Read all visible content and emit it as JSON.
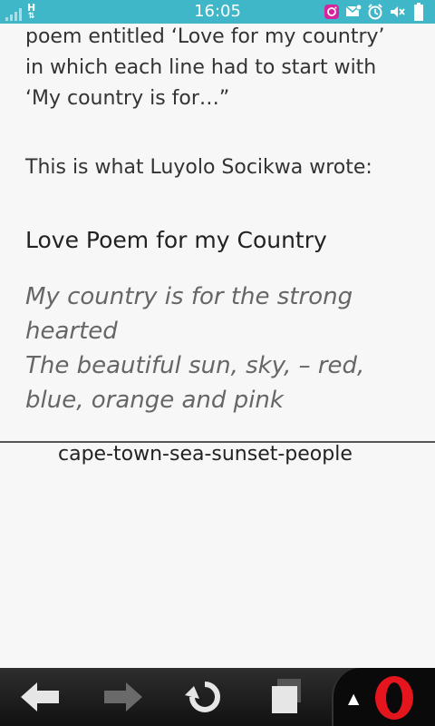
{
  "status_bar": {
    "network": "H",
    "time": "16:05",
    "icons": [
      "signal-icon",
      "instagram-icon",
      "message-icon",
      "alarm-icon",
      "mute-icon",
      "battery-icon"
    ]
  },
  "article": {
    "paragraph1": "poem entitled ‘Love for my country’ in which each line had to start with ‘My country is for…”",
    "paragraph2": "This is what Luyolo Socikwa wrote:",
    "poem_title": "Love Poem for my Country",
    "poem_lines": [
      "My country is for the strong",
      "hearted",
      "The beautiful sun, sky, – red,",
      "blue, orange and pink"
    ],
    "image_caption": "cape-town-sea-sunset-people"
  },
  "nav": {
    "buttons": [
      "back-icon",
      "forward-icon",
      "reload-icon",
      "tabs-icon",
      "opera-menu-icon"
    ],
    "colors": {
      "opera_red": "#e4151c"
    }
  }
}
